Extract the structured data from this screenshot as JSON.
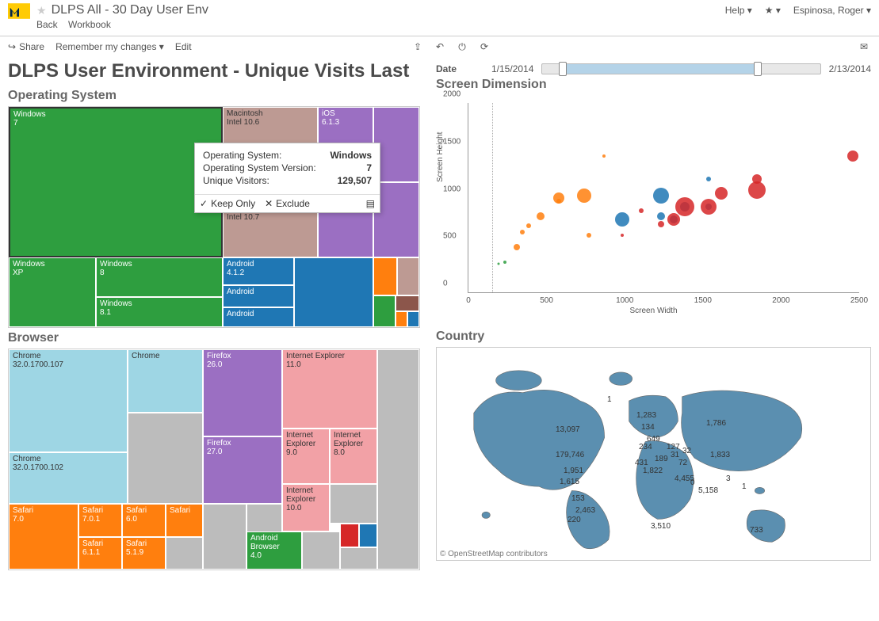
{
  "header": {
    "title": "DLPS All - 30 Day User Env",
    "back": "Back",
    "workbook": "Workbook",
    "help": "Help ▾",
    "user": "Espinosa, Roger ▾"
  },
  "toolbar": {
    "share": "Share",
    "remember": "Remember my changes ▾",
    "edit": "Edit"
  },
  "page_title": "DLPS User Environment - Unique Visits Last",
  "tooltip": {
    "os_label": "Operating System:",
    "os_value": "Windows",
    "ver_label": "Operating System Version:",
    "ver_value": "7",
    "uv_label": "Unique Visitors:",
    "uv_value": "129,507",
    "keep": "Keep Only",
    "exclude": "Exclude"
  },
  "sections": {
    "os": "Operating System",
    "browser": "Browser",
    "screen": "Screen Dimension",
    "country": "Country"
  },
  "date": {
    "label": "Date",
    "start": "1/15/2014",
    "end": "2/13/2014"
  },
  "scatter": {
    "xlabel": "Screen Width",
    "ylabel": "Screen Height",
    "xticks": [
      "0",
      "500",
      "1000",
      "1500",
      "2000",
      "2500"
    ],
    "yticks": [
      "0",
      "500",
      "1000",
      "1500",
      "2000"
    ]
  },
  "map": {
    "attribution": "© OpenStreetMap contributors"
  },
  "chart_data": [
    {
      "type": "treemap",
      "title": "Operating System",
      "items": [
        {
          "name": "Windows",
          "version": "7",
          "color": "#2e9e3f",
          "value": 129507
        },
        {
          "name": "Windows",
          "version": "XP",
          "color": "#2e9e3f",
          "value": 18000
        },
        {
          "name": "Windows",
          "version": "8",
          "color": "#2e9e3f",
          "value": 14000
        },
        {
          "name": "Windows",
          "version": "8.1",
          "color": "#2e9e3f",
          "value": 9000
        },
        {
          "name": "Macintosh",
          "version": "Intel 10.6",
          "color": "#bd9a93",
          "value": 22000
        },
        {
          "name": "Macintosh",
          "version": "Intel 10.7",
          "color": "#bd9a93",
          "value": 12000
        },
        {
          "name": "iOS",
          "version": "6.1.3",
          "color": "#9b6fc2",
          "value": 8000
        },
        {
          "name": "iOS",
          "version": "",
          "color": "#9b6fc2",
          "value": 5000
        },
        {
          "name": "Android",
          "version": "4.1.2",
          "color": "#1f77b4",
          "value": 7000
        },
        {
          "name": "Android",
          "version": "",
          "color": "#1f77b4",
          "value": 5000
        },
        {
          "name": "Android",
          "version": "",
          "color": "#1f77b4",
          "value": 4000
        }
      ]
    },
    {
      "type": "treemap",
      "title": "Browser",
      "items": [
        {
          "name": "Chrome",
          "version": "32.0.1700.107",
          "color": "#9ed6e4",
          "value": 60000
        },
        {
          "name": "Chrome",
          "version": "",
          "color": "#9ed6e4",
          "value": 30000
        },
        {
          "name": "Chrome",
          "version": "32.0.1700.102",
          "color": "#9ed6e4",
          "value": 25000
        },
        {
          "name": "Firefox",
          "version": "26.0",
          "color": "#9b6fc2",
          "value": 35000
        },
        {
          "name": "Firefox",
          "version": "27.0",
          "color": "#9b6fc2",
          "value": 20000
        },
        {
          "name": "Internet Explorer",
          "version": "11.0",
          "color": "#f2a1a6",
          "value": 25000
        },
        {
          "name": "Internet Explorer",
          "version": "9.0",
          "color": "#f2a1a6",
          "value": 10000
        },
        {
          "name": "Internet Explorer",
          "version": "8.0",
          "color": "#f2a1a6",
          "value": 9000
        },
        {
          "name": "Internet Explorer",
          "version": "10.0",
          "color": "#f2a1a6",
          "value": 8000
        },
        {
          "name": "Safari",
          "version": "7.0",
          "color": "#ff7f0e",
          "value": 18000
        },
        {
          "name": "Safari",
          "version": "7.0.1",
          "color": "#ff7f0e",
          "value": 10000
        },
        {
          "name": "Safari",
          "version": "6.0",
          "color": "#ff7f0e",
          "value": 8000
        },
        {
          "name": "Safari",
          "version": "5.1.9",
          "color": "#ff7f0e",
          "value": 6000
        },
        {
          "name": "Safari",
          "version": "6.1.1",
          "color": "#ff7f0e",
          "value": 6000
        },
        {
          "name": "Android Browser",
          "version": "4.0",
          "color": "#2e9e3f",
          "value": 8000
        }
      ]
    },
    {
      "type": "scatter",
      "title": "Screen Dimension",
      "xlabel": "Screen Width",
      "ylabel": "Screen Height",
      "xlim": [
        0,
        2600
      ],
      "ylim": [
        0,
        2000
      ],
      "series": [
        {
          "name": "orange",
          "color": "#ff7f0e",
          "points": [
            [
              320,
              480,
              8
            ],
            [
              360,
              640,
              6
            ],
            [
              400,
              700,
              6
            ],
            [
              480,
              800,
              10
            ],
            [
              600,
              1000,
              14
            ],
            [
              768,
              1024,
              18
            ],
            [
              800,
              600,
              6
            ],
            [
              600,
              960,
              6
            ],
            [
              900,
              1440,
              4
            ]
          ]
        },
        {
          "name": "blue",
          "color": "#1f77b4",
          "points": [
            [
              1024,
              768,
              18
            ],
            [
              1280,
              800,
              10
            ],
            [
              1280,
              1024,
              20
            ],
            [
              1366,
              768,
              10
            ],
            [
              1440,
              900,
              12
            ],
            [
              1600,
              900,
              8
            ],
            [
              1600,
              1200,
              6
            ]
          ]
        },
        {
          "name": "red",
          "color": "#d62728",
          "points": [
            [
              1280,
              720,
              8
            ],
            [
              1366,
              768,
              16
            ],
            [
              1440,
              900,
              24
            ],
            [
              1600,
              900,
              20
            ],
            [
              1680,
              1050,
              16
            ],
            [
              1920,
              1080,
              22
            ],
            [
              1920,
              1200,
              12
            ],
            [
              2560,
              1440,
              14
            ],
            [
              1152,
              864,
              6
            ],
            [
              1024,
              600,
              4
            ]
          ]
        },
        {
          "name": "green",
          "color": "#2e9e3f",
          "points": [
            [
              240,
              320,
              4
            ],
            [
              200,
              300,
              3
            ]
          ]
        }
      ]
    },
    {
      "type": "map",
      "title": "Country",
      "labels": [
        {
          "text": "179,746",
          "x": 150,
          "y": 130
        },
        {
          "text": "13,097",
          "x": 150,
          "y": 98
        },
        {
          "text": "1,951",
          "x": 160,
          "y": 150
        },
        {
          "text": "1,615",
          "x": 155,
          "y": 164
        },
        {
          "text": "2,463",
          "x": 175,
          "y": 200
        },
        {
          "text": "3,510",
          "x": 270,
          "y": 220
        },
        {
          "text": "220",
          "x": 165,
          "y": 212
        },
        {
          "text": "153",
          "x": 170,
          "y": 185
        },
        {
          "text": "1,283",
          "x": 252,
          "y": 80
        },
        {
          "text": "134",
          "x": 258,
          "y": 95
        },
        {
          "text": "649",
          "x": 265,
          "y": 110
        },
        {
          "text": "234",
          "x": 255,
          "y": 120
        },
        {
          "text": "431",
          "x": 250,
          "y": 140
        },
        {
          "text": "1,822",
          "x": 260,
          "y": 150
        },
        {
          "text": "4,455",
          "x": 300,
          "y": 160
        },
        {
          "text": "5,158",
          "x": 330,
          "y": 175
        },
        {
          "text": "127",
          "x": 290,
          "y": 120
        },
        {
          "text": "1,786",
          "x": 340,
          "y": 90
        },
        {
          "text": "32",
          "x": 310,
          "y": 125
        },
        {
          "text": "72",
          "x": 305,
          "y": 140
        },
        {
          "text": "31",
          "x": 295,
          "y": 130
        },
        {
          "text": "189",
          "x": 275,
          "y": 135
        },
        {
          "text": "0",
          "x": 320,
          "y": 165
        },
        {
          "text": "3",
          "x": 365,
          "y": 160
        },
        {
          "text": "1",
          "x": 385,
          "y": 170
        },
        {
          "text": "733",
          "x": 395,
          "y": 225
        },
        {
          "text": "1",
          "x": 215,
          "y": 60
        },
        {
          "text": "1,833",
          "x": 345,
          "y": 130
        }
      ]
    }
  ]
}
